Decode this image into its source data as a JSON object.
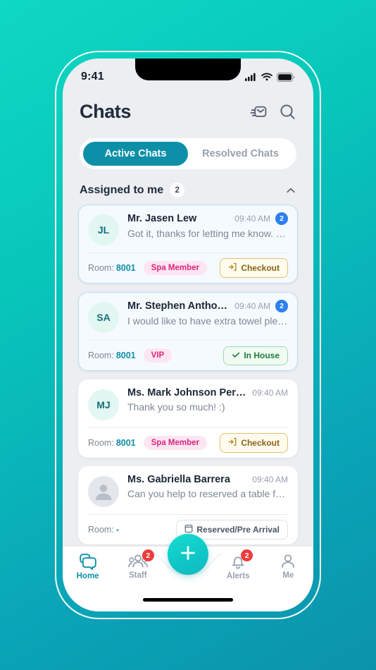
{
  "statusbar": {
    "time": "9:41",
    "signal_icon": "cellular-signal-icon",
    "wifi_icon": "wifi-icon",
    "battery_icon": "battery-icon"
  },
  "header": {
    "title": "Chats",
    "mark_read_icon": "message-inbox-icon",
    "search_icon": "search-icon"
  },
  "tabs": [
    {
      "label": "Active Chats",
      "active": true
    },
    {
      "label": "Resolved Chats",
      "active": false
    }
  ],
  "section": {
    "title": "Assigned to me",
    "count": "2",
    "chevron_icon": "chevron-up-icon"
  },
  "chats": [
    {
      "initials": "JL",
      "name": "Mr. Jasen Lew",
      "preview": "Got it, thanks for letting me know. Wil...",
      "time": "09:40 AM",
      "unread": "2",
      "room_label": "Room:",
      "room": "8001",
      "tag": "Spa Member",
      "status": "Checkout",
      "status_type": "checkout",
      "status_icon": "checkout-exit-icon",
      "highlight": true,
      "has_avatar": true
    },
    {
      "initials": "SA",
      "name": "Mr. Stephen Anthony",
      "preview": "I would like to have extra towel please..",
      "time": "09:40 AM",
      "unread": "2",
      "room_label": "Room:",
      "room": "8001",
      "tag": "VIP",
      "status": "In House",
      "status_type": "inhouse",
      "status_icon": "check-icon",
      "highlight": true,
      "has_avatar": true
    },
    {
      "initials": "MJ",
      "name": "Ms. Mark Johnson Perera...",
      "preview": "Thank you so much! :)",
      "time": "09:40 AM",
      "unread": "",
      "room_label": "Room:",
      "room": "8001",
      "tag": "Spa Member",
      "status": "Checkout",
      "status_type": "checkout",
      "status_icon": "checkout-exit-icon",
      "highlight": false,
      "has_avatar": true
    },
    {
      "initials": "",
      "name": "Ms. Gabriella Barrera",
      "preview": "Can you help to reserved a table for t...",
      "time": "09:40 AM",
      "unread": "",
      "room_label": "Room:",
      "room": "-",
      "tag": "",
      "status": "Reserved/Pre Arrival",
      "status_type": "reserved",
      "status_icon": "calendar-icon",
      "highlight": false,
      "has_avatar": false
    }
  ],
  "fab": {
    "icon": "plus-icon"
  },
  "bottom_nav": [
    {
      "label": "Home",
      "icon": "chat-bubbles-icon",
      "badge": "",
      "active": true
    },
    {
      "label": "Staff",
      "icon": "people-group-icon",
      "badge": "2",
      "active": false
    },
    {
      "label": "Alerts",
      "icon": "bell-icon",
      "badge": "2",
      "active": false
    },
    {
      "label": "Me",
      "icon": "person-icon",
      "badge": "",
      "active": false
    }
  ],
  "colors": {
    "brand_teal": "#0e8fa8",
    "accent_cyan": "#12c8c4",
    "unread_blue": "#2d7ff0",
    "badge_red": "#f03c3c",
    "tag_pink": "#d8257f",
    "checkout_amber": "#8a6312",
    "inhouse_green": "#1f7d3a"
  }
}
